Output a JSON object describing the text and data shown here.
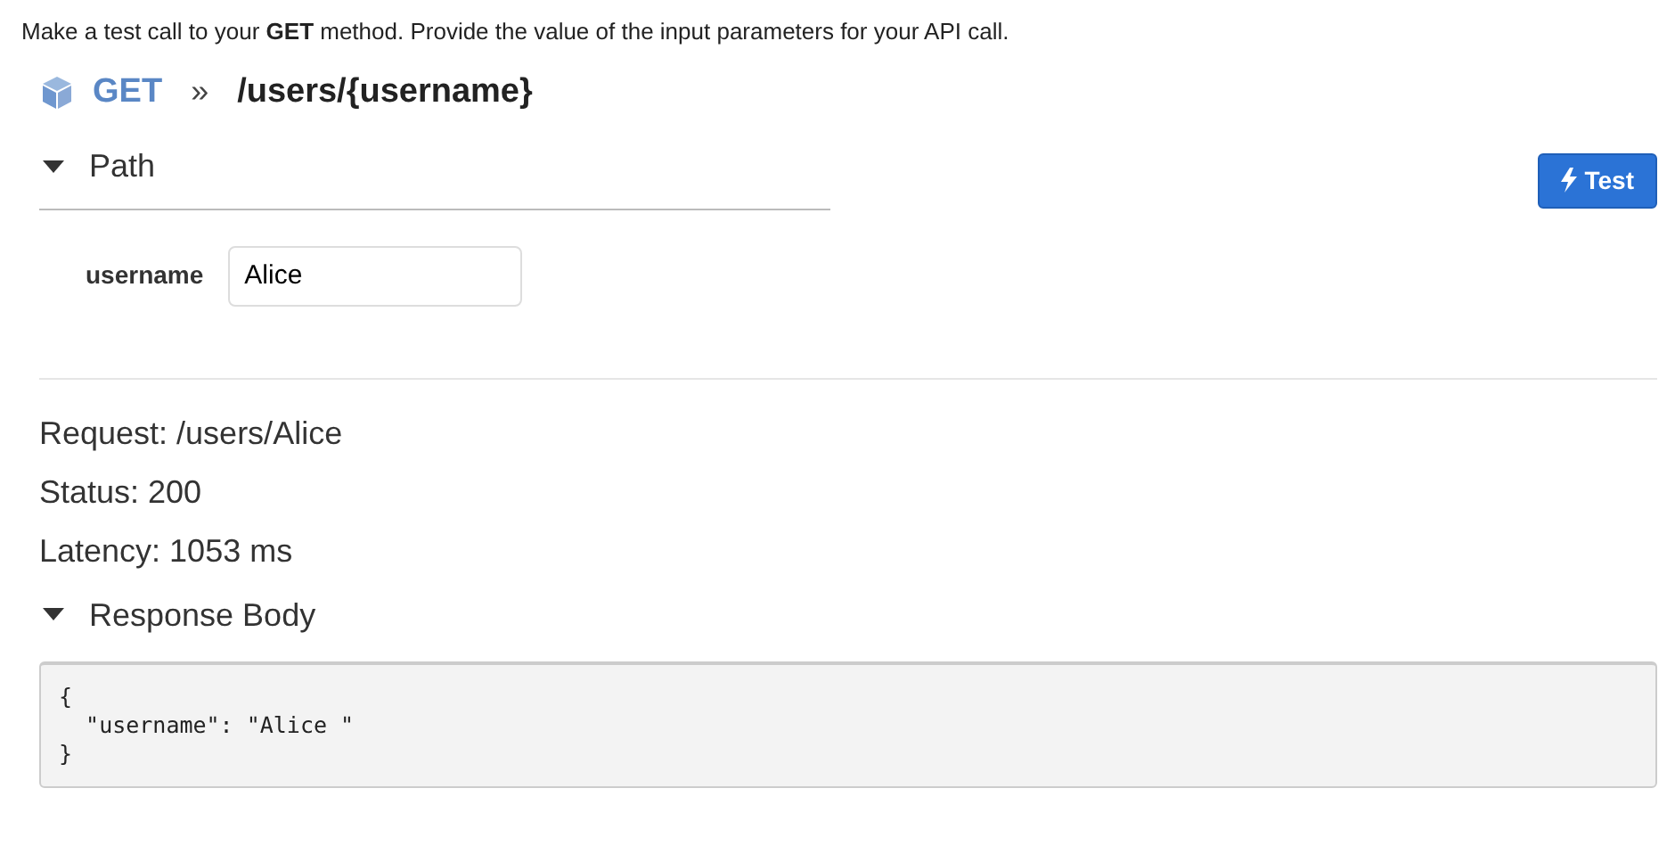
{
  "intro": "Make a test call to your **GET** method. Provide the value of the input parameters for your API call.",
  "header": {
    "method": "GET",
    "separator": "»",
    "path": "/users/{username}"
  },
  "test_button": {
    "label": "Test"
  },
  "path_section": {
    "title": "Path",
    "expanded": true,
    "params": [
      {
        "label": "username",
        "value": "Alice"
      }
    ]
  },
  "results": [
    "Request: /users/Alice",
    "Status: 200",
    "Latency: 1053 ms"
  ],
  "response_section": {
    "title": "Response Body",
    "expanded": true,
    "lines": [
      "{",
      "  \"username\": \"Alice \"",
      "}"
    ]
  }
}
